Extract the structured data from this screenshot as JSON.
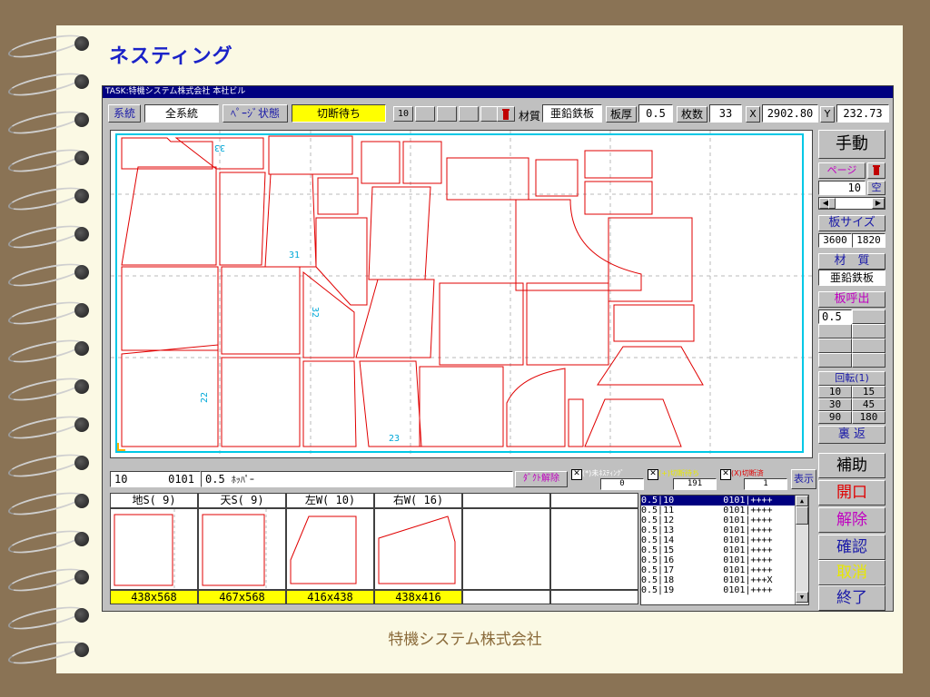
{
  "slide": {
    "title": "ネスティング",
    "footer": "特機システム株式会社"
  },
  "window": {
    "title": "TASK:特機システム株式会社 本社ビル"
  },
  "toolbar": {
    "keito_btn": "系統",
    "keito_value": "全系統",
    "page_state_btn": "ﾍﾟｰｼﾞ状態",
    "page_state_value": "切断待ち",
    "page_num": "10",
    "material_label": "材質",
    "material_value": "亜鉛鉄板",
    "thickness_label": "板厚",
    "thickness_value": "0.5",
    "count_label": "枚数",
    "count_value": "33",
    "x_label": "X",
    "x_value": "2902.80",
    "y_label": "Y",
    "y_value": "232.73"
  },
  "canvas_labels": {
    "a": "33",
    "b": "31",
    "c": "32",
    "d": "22",
    "e": "23"
  },
  "right_panel": {
    "manual": "手動",
    "page_label": "ページ",
    "page_value": "10",
    "empty_btn": "空",
    "sheet_size_label": "板サイズ",
    "sheet_w": "3600",
    "sheet_h": "1820",
    "material_label": "材　質",
    "material_value": "亜鉛鉄板",
    "call_label": "板呼出",
    "call_value": "0.5",
    "rotate_label": "回転(1)",
    "rot": [
      "10",
      "15",
      "30",
      "45",
      "90",
      "180"
    ],
    "flip": "裏 返",
    "assist": "補助",
    "open": "開口",
    "release": "解除",
    "confirm": "確認",
    "cancel": "取消",
    "exit": "終了"
  },
  "bottom": {
    "info_id": "10",
    "info_code": "0101",
    "info_thick": "0.5",
    "info_name": "ﾎｯﾊﾟｰ",
    "duct_release": "ﾀﾞｸﾄ解除",
    "chk1_label": "(*)未ﾈｽﾃｨﾝｸﾞ",
    "chk1_count": "0",
    "chk2_label": "(+)切断待ち",
    "chk2_count": "191",
    "chk3_label": "(X)切断済",
    "chk3_count": "1",
    "show_btn": "表示",
    "thumbs": [
      {
        "head": "地S( 9)",
        "size": "438x568"
      },
      {
        "head": "天S( 9)",
        "size": "467x568"
      },
      {
        "head": "左W( 10)",
        "size": "416x438"
      },
      {
        "head": "右W( 16)",
        "size": "438x416"
      }
    ],
    "list": [
      "0.5|10         0101|++++",
      "0.5|11         0101|++++",
      "0.5|12         0101|++++",
      "0.5|13         0101|++++",
      "0.5|14         0101|++++",
      "0.5|15         0101|++++",
      "0.5|16         0101|++++",
      "0.5|17         0101|++++",
      "0.5|18         0101|+++X",
      "0.5|19         0101|++++"
    ]
  },
  "colors": {
    "title_blue": "#1a22c8",
    "window_title": "#000080",
    "part_outline": "#e00000",
    "sheet_outline": "#00c8e6",
    "highlight_yellow": "#ffff00"
  }
}
